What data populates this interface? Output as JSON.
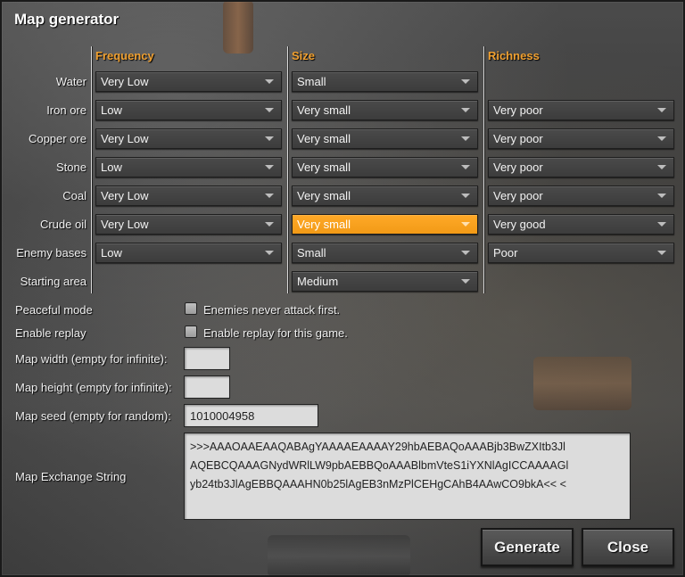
{
  "title": "Map generator",
  "columns": {
    "frequency": "Frequency",
    "size": "Size",
    "richness": "Richness"
  },
  "resources": [
    {
      "label": "Water",
      "frequency": "Very Low",
      "size": "Small",
      "richness": null
    },
    {
      "label": "Iron ore",
      "frequency": "Low",
      "size": "Very small",
      "richness": "Very poor"
    },
    {
      "label": "Copper ore",
      "frequency": "Very Low",
      "size": "Very small",
      "richness": "Very poor"
    },
    {
      "label": "Stone",
      "frequency": "Low",
      "size": "Very small",
      "richness": "Very poor"
    },
    {
      "label": "Coal",
      "frequency": "Very Low",
      "size": "Very small",
      "richness": "Very poor"
    },
    {
      "label": "Crude oil",
      "frequency": "Very Low",
      "size": "Very small",
      "richness": "Very good"
    },
    {
      "label": "Enemy bases",
      "frequency": "Low",
      "size": "Small",
      "richness": "Poor"
    },
    {
      "label": "Starting area",
      "frequency": null,
      "size": "Medium",
      "richness": null
    }
  ],
  "highlight_color": "#f29a16",
  "options": {
    "peaceful_label": "Peaceful mode",
    "peaceful_text": "Enemies never attack first.",
    "replay_label": "Enable replay",
    "replay_text": "Enable replay for this game.",
    "width_label": "Map width (empty for infinite):",
    "width_value": "",
    "height_label": "Map height (empty for infinite):",
    "height_value": "",
    "seed_label": "Map seed (empty for random):",
    "seed_value": "1010004958",
    "exchange_label": "Map Exchange String",
    "exchange_lines": [
      ">>>AAAOAAEAAQABAgYAAAAEAAAAY29hbAEBAQoAAABjb3BwZXItb3Jl",
      "AQEBCQAAAGNydWRlLW9pbAEBBQoAAABlbmVteS1iYXNlAgICCAAAAGl",
      "yb24tb3JlAgEBBQAAAHN0b25lAgEB3nMzPlCEHgCAhB4AAwCO9bkA<< <"
    ]
  },
  "buttons": {
    "generate": "Generate",
    "close": "Close"
  }
}
